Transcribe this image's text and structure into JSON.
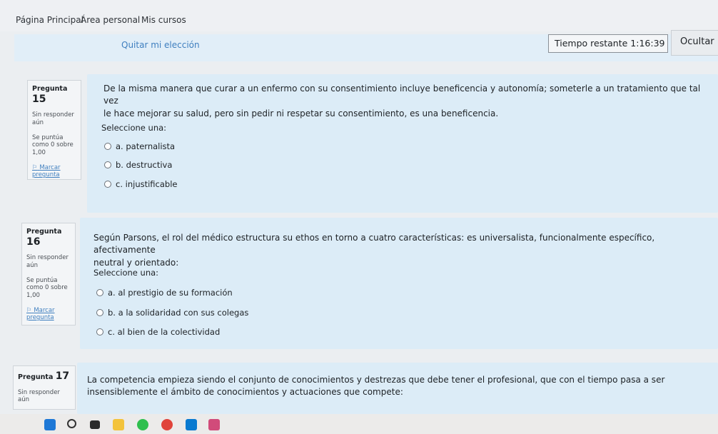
{
  "nav": {
    "home": "Página Principal",
    "personal": "Área personal",
    "courses": "Mis cursos"
  },
  "top": {
    "clear_choice": "Quitar mi elección",
    "timer_label": "Tiempo restante",
    "timer_value": "1:16:39",
    "hide_button": "Ocultar"
  },
  "questions": [
    {
      "label": "Pregunta",
      "number": "15",
      "status": "Sin responder aún",
      "points": "Se puntúa como 0 sobre 1,00",
      "flag": "Marcar pregunta",
      "text_line1": "De la misma manera que curar a un enfermo con su consentimiento incluye beneficencia y autonomía; someterle a un tratamiento que tal vez",
      "text_line2": "le hace mejorar su salud, pero sin pedir ni respetar su consentimiento, es una beneficencia.",
      "select_one": "Seleccione una:",
      "options": [
        "a.  paternalista",
        "b.  destructiva",
        "c.  injustificable"
      ]
    },
    {
      "label": "Pregunta",
      "number": "16",
      "status": "Sin responder aún",
      "points": "Se puntúa como 0 sobre 1,00",
      "flag": "Marcar pregunta",
      "text_line1": "Según Parsons, el rol del médico estructura su ethos en torno a cuatro características: es universalista, funcionalmente específico, afectivamente",
      "text_line2": "neutral y orientado:",
      "select_one": "Seleccione una:",
      "options": [
        "a.  al prestigio de su formación",
        "b.  a la solidaridad con sus colegas",
        "c.  al bien de la colectividad"
      ]
    },
    {
      "label": "Pregunta",
      "number": "17",
      "status": "Sin responder aún",
      "text_line1": "La competencia empieza siendo el conjunto de conocimientos y destrezas que debe tener el profesional, que con el tiempo pasa a ser",
      "text_line2": "insensiblemente el ámbito de conocimientos y actuaciones que compete:"
    }
  ],
  "taskbar": {
    "icons": [
      "windows-icon",
      "search-icon",
      "task-view-icon",
      "file-explorer-icon",
      "whatsapp-icon",
      "chrome-icon",
      "app-icon",
      "app-icon-2"
    ]
  }
}
